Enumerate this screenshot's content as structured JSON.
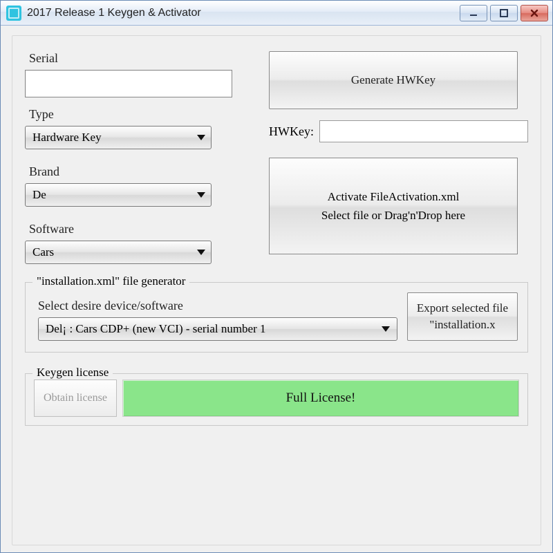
{
  "window": {
    "title": "2017 Release 1 Keygen & Activator"
  },
  "left": {
    "serial_label": "Serial",
    "serial_value": "",
    "type_label": "Type",
    "type_value": "Hardware Key",
    "brand_label": "Brand",
    "brand_value": "De",
    "software_label": "Software",
    "software_value": "Cars"
  },
  "right": {
    "generate_btn": "Generate HWKey",
    "hwkey_label": "HWKey:",
    "hwkey_value": "",
    "activate_text": "Activate FileActivation.xml\nSelect file or Drag'n'Drop here"
  },
  "install": {
    "legend": "\"installation.xml\" file generator",
    "select_label": "Select desire device/software",
    "device_value": "Del¡ : Cars CDP+ (new VCI) - serial number 1",
    "export_btn": "Export selected file \"installation.x"
  },
  "license": {
    "legend": "Keygen license",
    "obtain_btn": "Obtain license",
    "full_btn": "Full License!"
  }
}
